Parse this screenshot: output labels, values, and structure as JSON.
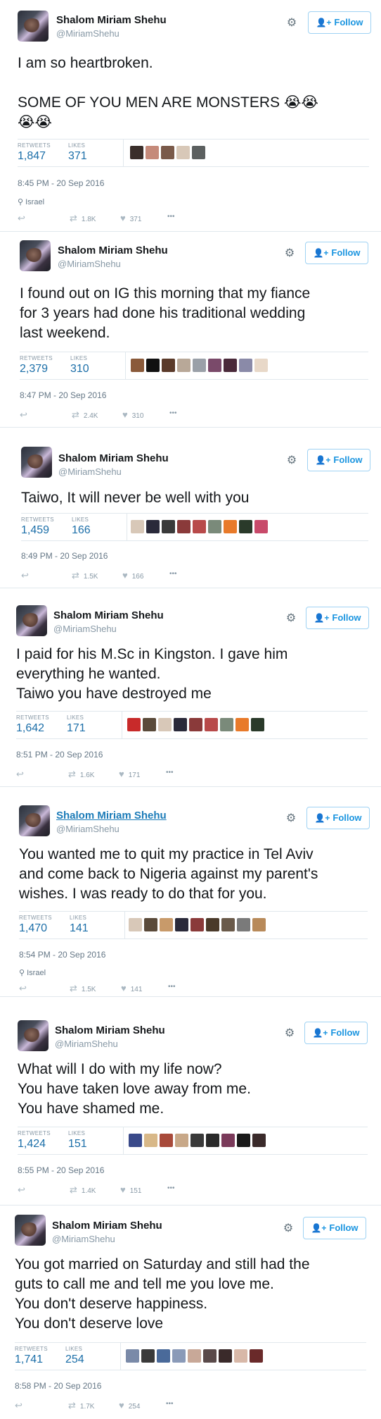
{
  "follow_label": "Follow",
  "tweets": [
    {
      "name": "Shalom Miriam Shehu",
      "handle": "@MiriamShehu",
      "text": "I am so heartbroken.\n\nSOME OF YOU MEN ARE MONSTERS 😭😭\n😭😭",
      "retweets_label": "RETWEETS",
      "retweets": "1,847",
      "likes_label": "LIKES",
      "likes": "371",
      "time": "8:45 PM - 20 Sep 2016",
      "location": "Israel",
      "rt_count": "1.8K",
      "like_count": "371"
    },
    {
      "name": "Shalom Miriam Shehu",
      "handle": "@MiriamShehu",
      "text": "I found out on IG this morning that my fiance\nfor 3 years had done his traditional wedding\nlast weekend.",
      "retweets_label": "RETWEETS",
      "retweets": "2,379",
      "likes_label": "LIKES",
      "likes": "310",
      "time": "8:47 PM - 20 Sep 2016",
      "rt_count": "2.4K",
      "like_count": "310"
    },
    {
      "name": "Shalom Miriam Shehu",
      "handle": "@MiriamShehu",
      "text": "Taiwo, It will never be well with you",
      "retweets_label": "RETWEETS",
      "retweets": "1,459",
      "likes_label": "LIKES",
      "likes": "166",
      "time": "8:49 PM - 20 Sep 2016",
      "rt_count": "1.5K",
      "like_count": "166"
    },
    {
      "name": "Shalom Miriam Shehu",
      "handle": "@MiriamShehu",
      "text": "I paid for his M.Sc in Kingston. I gave him\neverything he wanted.\nTaiwo you have destroyed me",
      "retweets_label": "RETWEETS",
      "retweets": "1,642",
      "likes_label": "LIKES",
      "likes": "171",
      "time": "8:51 PM - 20 Sep 2016",
      "rt_count": "1.6K",
      "like_count": "171"
    },
    {
      "name": "Shalom Miriam Shehu",
      "handle": "@MiriamShehu",
      "text": "You wanted me to quit my practice in Tel Aviv\nand come back to Nigeria against my parent's\nwishes. I was ready to do that for you.",
      "retweets_label": "RETWEETS",
      "retweets": "1,470",
      "likes_label": "LIKES",
      "likes": "141",
      "time": "8:54 PM - 20 Sep 2016",
      "location": "Israel",
      "rt_count": "1.5K",
      "like_count": "141"
    },
    {
      "name": "Shalom Miriam Shehu",
      "handle": "@MiriamShehu",
      "text": "What will I do with my life now?\nYou have taken love away from me.\nYou have shamed me.",
      "retweets_label": "RETWEETS",
      "retweets": "1,424",
      "likes_label": "LIKES",
      "likes": "151",
      "time": "8:55 PM - 20 Sep 2016",
      "rt_count": "1.4K",
      "like_count": "151"
    },
    {
      "name": "Shalom Miriam Shehu",
      "handle": "@MiriamShehu",
      "text": "You got married on Saturday and still had the\nguts to call me and tell me you love me.\nYou don't deserve happiness.\nYou don't deserve love",
      "retweets_label": "RETWEETS",
      "retweets": "1,741",
      "likes_label": "LIKES",
      "likes": "254",
      "time": "8:58 PM - 20 Sep 2016",
      "rt_count": "1.7K",
      "like_count": "254"
    }
  ],
  "icons": {
    "gear": "gear-icon",
    "follow": "person-plus-icon",
    "location": "map-pin-icon",
    "reply": "reply-icon",
    "retweet": "retweet-icon",
    "like": "heart-icon",
    "more": "more-icon"
  },
  "colors": {
    "link_blue": "#1b95e0",
    "stat_blue": "#1b6ea8",
    "muted": "#8899a6"
  }
}
